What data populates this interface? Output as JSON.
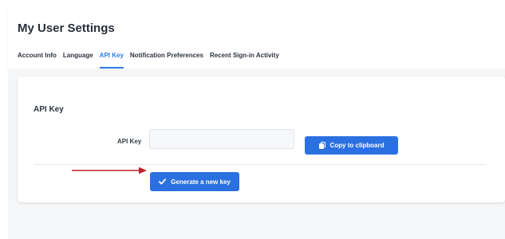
{
  "page": {
    "title": "My User Settings"
  },
  "tabs": [
    {
      "label": "Account Info",
      "active": false
    },
    {
      "label": "Language",
      "active": false
    },
    {
      "label": "API Key",
      "active": true
    },
    {
      "label": "Notification Preferences",
      "active": false
    },
    {
      "label": "Recent Sign-in Activity",
      "active": false
    }
  ],
  "card": {
    "title": "API Key",
    "field_label": "API Key",
    "api_key_value": "",
    "copy_button_label": "Copy to clipboard",
    "generate_button_label": "Generate a new key"
  },
  "icons": {
    "copy": "copy-icon",
    "generate": "checkmark-icon",
    "annotation": "red-arrow"
  },
  "colors": {
    "accent": "#2b70e0",
    "active_tab": "#2f7de1",
    "annotation_arrow": "#c0202a"
  }
}
